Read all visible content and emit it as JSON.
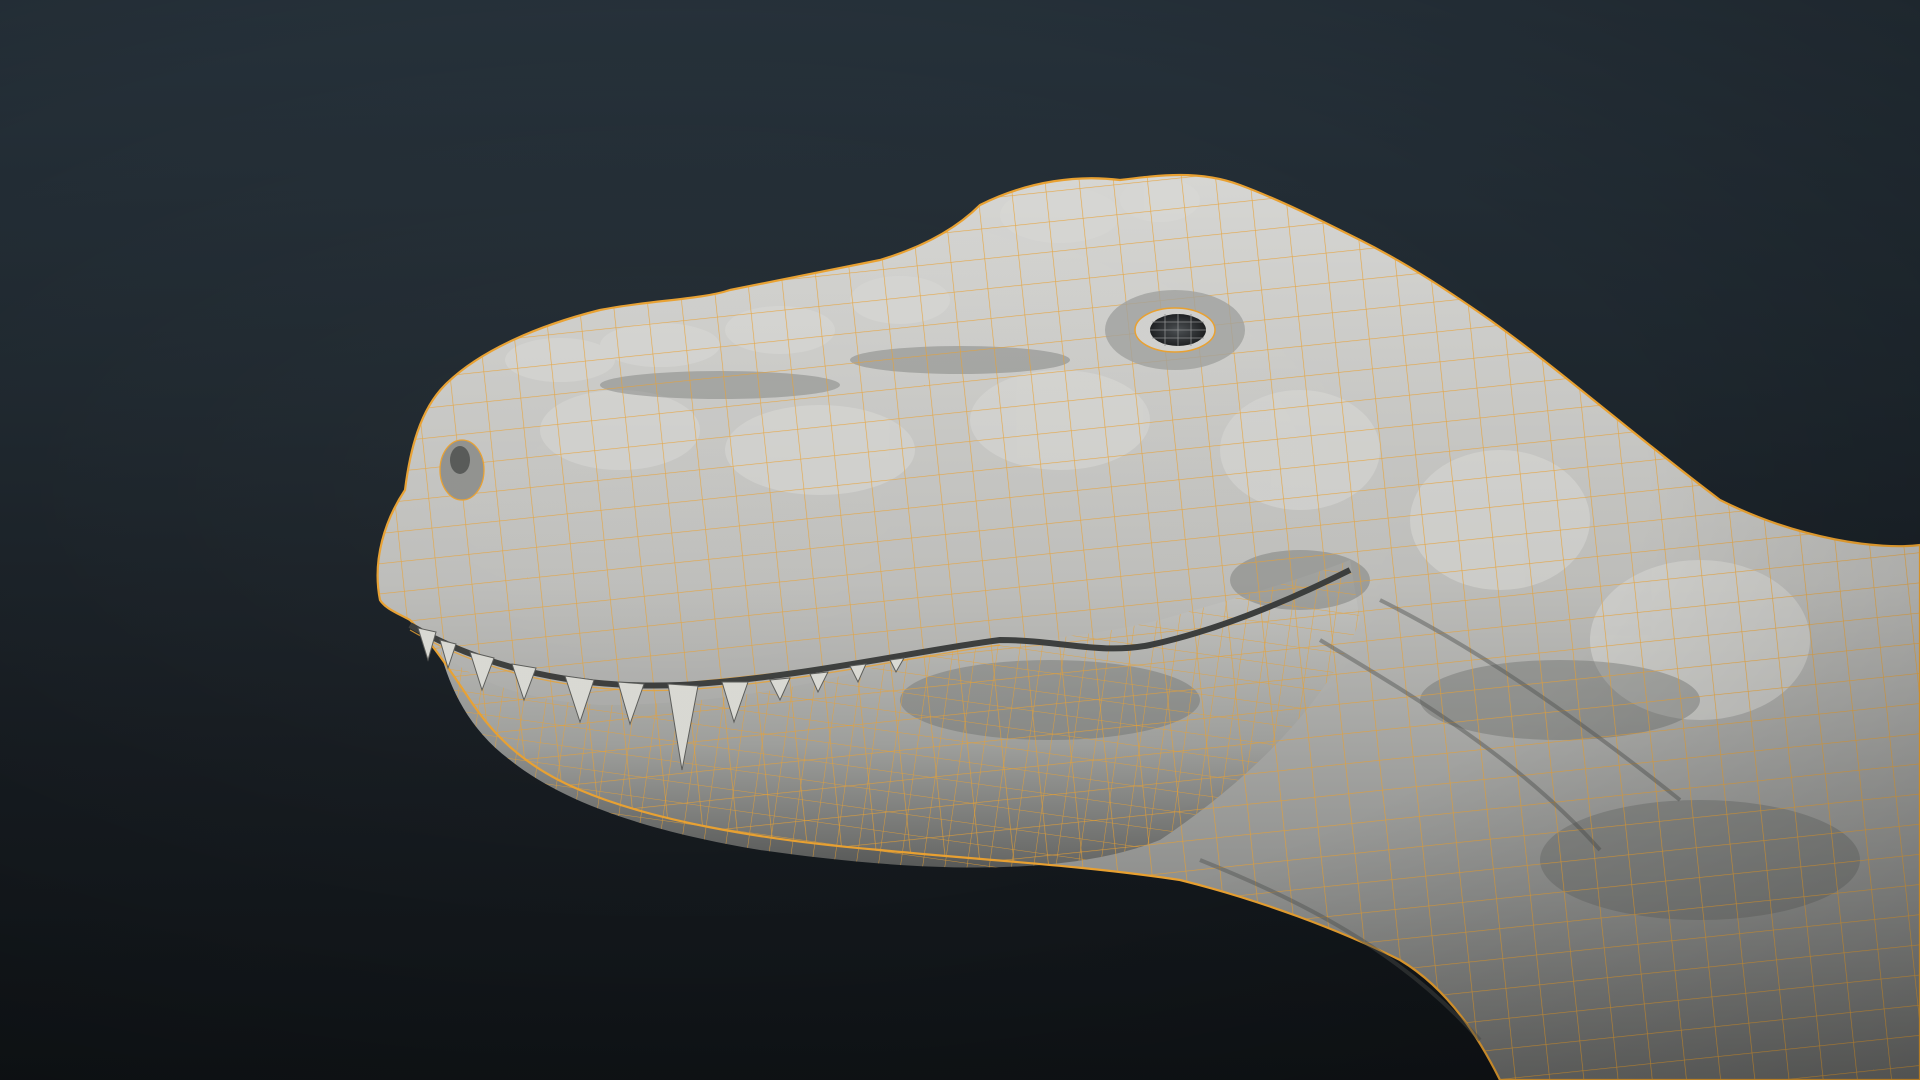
{
  "scene": {
    "subject": "",
    "colors": {
      "background_top": "#26313a",
      "background_bottom": "#0f1316",
      "mesh_surface": "#bdbdbb",
      "mesh_surface_light": "#dcdcda",
      "mesh_surface_shadow": "#6f716f",
      "wireframe": "#e8a030",
      "teeth": "#d8d8d2",
      "eye": "#2c2f31"
    }
  }
}
